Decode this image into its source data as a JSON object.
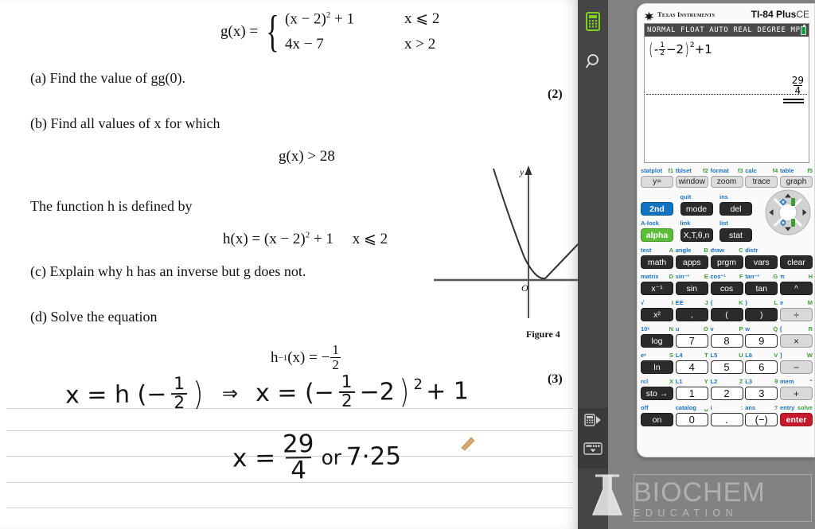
{
  "document": {
    "function_def": {
      "lhs": "g(x) =",
      "case1_expr": "(x − 2)",
      "case1_sup": "2",
      "case1_tail": " + 1",
      "case1_cond": "x ⩽ 2",
      "case2_expr": "4x − 7",
      "case2_cond": "x > 2"
    },
    "questions": [
      {
        "label": "(a)",
        "text": "Find the value of  gg(0).",
        "marks": "(2)"
      },
      {
        "label": "(b)",
        "text": "Find all values of x for which",
        "marks": ""
      },
      {
        "label": "(c)",
        "text": "Explain why h has an inverse but g does not.",
        "marks": ""
      },
      {
        "label": "(d)",
        "text": "Solve the equation",
        "marks": "(3)"
      }
    ],
    "inequality": "g(x) > 28",
    "h_intro": "The function h is defined by",
    "h_def": {
      "lhs": "h(x) = (x − 2)",
      "sup": "2",
      "tail": " + 1",
      "cond": "x ⩽ 2"
    },
    "h_inverse": {
      "lhs": "h",
      "sup": "−1",
      "mid": "(x) =  −",
      "frac_num": "1",
      "frac_den": "2"
    },
    "figure": {
      "caption": "Figure 4",
      "y_axis_label": "y",
      "origin_label": "O"
    },
    "handwriting": {
      "line1_part1": "x = h (−",
      "line1_frac_num": "1",
      "line1_frac_den": "2",
      "line1_close": ")",
      "line1_arrow": "⇒",
      "line1_part2_lead": "x = (−",
      "line1_part2_frac_num": "1",
      "line1_part2_frac_den": "2",
      "line1_part2_mid": "−2",
      "line1_part2_sup": "2",
      "line1_part2_tail": "+ 1",
      "line2_lead": "x =",
      "line2_frac_num": "29",
      "line2_frac_den": "4",
      "line2_or": "or",
      "line2_decimal": "7·25"
    }
  },
  "toolbar": {
    "items": [
      {
        "name": "calculator-icon",
        "label": "Calculator"
      },
      {
        "name": "search-icon",
        "label": "Search"
      },
      {
        "name": "step-through-icon",
        "label": "Step"
      },
      {
        "name": "keyboard-icon",
        "label": "Keyboard"
      }
    ]
  },
  "calculator": {
    "brand": "Texas Instruments",
    "model_bold": "TI-84 Plus",
    "model_light": "CE",
    "screen": {
      "status": "NORMAL FLOAT AUTO REAL DEGREE MP",
      "entry": {
        "open_paren": "(",
        "minus": "-",
        "frac_num": "1",
        "frac_den": "2",
        "mid": "−2",
        "close_paren": ")",
        "sup": "2",
        "tail": "+1"
      },
      "result": {
        "num": "29",
        "den": "4"
      }
    },
    "fn_labels": [
      {
        "above": "statplot",
        "fkey": "f1"
      },
      {
        "above": "tblset",
        "fkey": "f2"
      },
      {
        "above": "format",
        "fkey": "f3"
      },
      {
        "above": "calc",
        "fkey": "f4"
      },
      {
        "above": "table",
        "fkey": "f5"
      }
    ],
    "fn_keys": [
      "y=",
      "window",
      "zoom",
      "trace",
      "graph"
    ],
    "rows": [
      {
        "labels": [
          {
            "blue": "",
            "green": ""
          },
          {
            "blue": "quit",
            "green": ""
          },
          {
            "blue": "ins",
            "green": ""
          }
        ],
        "keys": [
          {
            "label": "2nd",
            "style": "blue"
          },
          {
            "label": "mode",
            "style": "dark"
          },
          {
            "label": "del",
            "style": "dark"
          }
        ]
      },
      {
        "labels": [
          {
            "blue": "A-lock",
            "green": ""
          },
          {
            "blue": "link",
            "green": ""
          },
          {
            "blue": "list",
            "green": ""
          }
        ],
        "keys": [
          {
            "label": "alpha",
            "style": "green"
          },
          {
            "label": "X,T,θ,n",
            "style": "dark"
          },
          {
            "label": "stat",
            "style": "dark"
          }
        ]
      },
      {
        "labels": [
          {
            "blue": "test",
            "green": "A"
          },
          {
            "blue": "angle",
            "green": "B"
          },
          {
            "blue": "draw",
            "green": "C"
          },
          {
            "blue": "distr",
            "green": ""
          },
          {
            "blue": "",
            "green": ""
          }
        ],
        "keys": [
          {
            "label": "math",
            "style": "dark"
          },
          {
            "label": "apps",
            "style": "dark"
          },
          {
            "label": "prgm",
            "style": "dark"
          },
          {
            "label": "vars",
            "style": "dark"
          },
          {
            "label": "clear",
            "style": "dark"
          }
        ]
      },
      {
        "labels": [
          {
            "blue": "matrix",
            "green": "D"
          },
          {
            "blue": "sin⁻¹",
            "green": "E"
          },
          {
            "blue": "cos⁻¹",
            "green": "F"
          },
          {
            "blue": "tan⁻¹",
            "green": "G"
          },
          {
            "blue": "π",
            "green": "H"
          }
        ],
        "keys": [
          {
            "label": "x⁻¹",
            "style": "dark"
          },
          {
            "label": "sin",
            "style": "dark"
          },
          {
            "label": "cos",
            "style": "dark"
          },
          {
            "label": "tan",
            "style": "dark"
          },
          {
            "label": "^",
            "style": "dark"
          }
        ]
      },
      {
        "labels": [
          {
            "blue": "√",
            "green": "I"
          },
          {
            "blue": "EE",
            "green": "J"
          },
          {
            "blue": "{",
            "green": "K"
          },
          {
            "blue": "}",
            "green": "L"
          },
          {
            "blue": "e",
            "green": "M"
          }
        ],
        "keys": [
          {
            "label": "x²",
            "style": "dark"
          },
          {
            "label": ",",
            "style": "dark"
          },
          {
            "label": "(",
            "style": "dark"
          },
          {
            "label": ")",
            "style": "dark"
          },
          {
            "label": "÷",
            "style": "grey"
          }
        ]
      },
      {
        "labels": [
          {
            "blue": "10ˣ",
            "green": "N"
          },
          {
            "blue": "u",
            "green": "O"
          },
          {
            "blue": "v",
            "green": "P"
          },
          {
            "blue": "w",
            "green": "Q"
          },
          {
            "blue": "[",
            "green": "R"
          }
        ],
        "keys": [
          {
            "label": "log",
            "style": "dark"
          },
          {
            "label": "7",
            "style": "white"
          },
          {
            "label": "8",
            "style": "white"
          },
          {
            "label": "9",
            "style": "white"
          },
          {
            "label": "×",
            "style": "grey"
          }
        ]
      },
      {
        "labels": [
          {
            "blue": "eˣ",
            "green": "S"
          },
          {
            "blue": "L4",
            "green": "T"
          },
          {
            "blue": "L5",
            "green": "U"
          },
          {
            "blue": "L6",
            "green": "V"
          },
          {
            "blue": "]",
            "green": "W"
          }
        ],
        "keys": [
          {
            "label": "ln",
            "style": "dark"
          },
          {
            "label": "4",
            "style": "white"
          },
          {
            "label": "5",
            "style": "white"
          },
          {
            "label": "6",
            "style": "white"
          },
          {
            "label": "−",
            "style": "grey"
          }
        ]
      },
      {
        "labels": [
          {
            "blue": "rcl",
            "green": "X"
          },
          {
            "blue": "L1",
            "green": "Y"
          },
          {
            "blue": "L2",
            "green": "Z"
          },
          {
            "blue": "L3",
            "green": "θ"
          },
          {
            "blue": "mem",
            "green": "“"
          }
        ],
        "keys": [
          {
            "label": "sto →",
            "style": "dark"
          },
          {
            "label": "1",
            "style": "white"
          },
          {
            "label": "2",
            "style": "white"
          },
          {
            "label": "3",
            "style": "white"
          },
          {
            "label": "+",
            "style": "grey"
          }
        ]
      },
      {
        "labels": [
          {
            "blue": "off",
            "green": ""
          },
          {
            "blue": "catalog",
            "green": "␣"
          },
          {
            "blue": "i",
            "green": ":"
          },
          {
            "blue": "ans",
            "green": "?"
          },
          {
            "blue": "entry",
            "green": "solve"
          }
        ],
        "keys": [
          {
            "label": "on",
            "style": "dark"
          },
          {
            "label": "0",
            "style": "white"
          },
          {
            "label": ".",
            "style": "white"
          },
          {
            "label": "(−)",
            "style": "white"
          },
          {
            "label": "enter",
            "style": "red"
          }
        ]
      }
    ]
  },
  "watermark": {
    "title": "BIOCHEM",
    "subtitle": "EDUCATION"
  },
  "colors": {
    "accent_blue": "#1172c0",
    "accent_green": "#5cbd3a",
    "enter_red": "#c51a2b",
    "toolbar_dark": "#454545",
    "gutter_grey": "#828282",
    "label_blue": "#1a72c6",
    "label_green": "#3f9b35"
  }
}
